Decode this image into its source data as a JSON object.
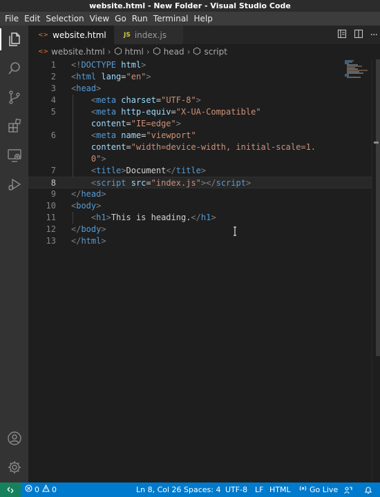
{
  "window": {
    "title": "website.html - New Folder - Visual Studio Code"
  },
  "menu": [
    "File",
    "Edit",
    "Selection",
    "View",
    "Go",
    "Run",
    "Terminal",
    "Help"
  ],
  "tabs": [
    {
      "label": "website.html",
      "icon": "<>",
      "active": true,
      "close": "×"
    },
    {
      "label": "index.js",
      "icon": "JS",
      "active": false
    }
  ],
  "breadcrumb": {
    "file": "website.html",
    "items": [
      "html",
      "head",
      "script"
    ]
  },
  "editor": {
    "current_line": 8,
    "lines": [
      [
        {
          "c": "t",
          "v": "<!"
        },
        {
          "c": "tag",
          "v": "DOCTYPE"
        },
        {
          "c": "txt",
          "v": " "
        },
        {
          "c": "attr",
          "v": "html"
        },
        {
          "c": "t",
          "v": ">"
        }
      ],
      [
        {
          "c": "t",
          "v": "<"
        },
        {
          "c": "tag",
          "v": "html"
        },
        {
          "c": "txt",
          "v": " "
        },
        {
          "c": "attr",
          "v": "lang"
        },
        {
          "c": "txt",
          "v": "="
        },
        {
          "c": "str",
          "v": "\"en\""
        },
        {
          "c": "t",
          "v": ">"
        }
      ],
      [
        {
          "c": "t",
          "v": "<"
        },
        {
          "c": "tag",
          "v": "head"
        },
        {
          "c": "t",
          "v": ">"
        }
      ],
      [
        {
          "c": "txt",
          "v": "    "
        },
        {
          "c": "t",
          "v": "<"
        },
        {
          "c": "tag",
          "v": "meta"
        },
        {
          "c": "txt",
          "v": " "
        },
        {
          "c": "attr",
          "v": "charset"
        },
        {
          "c": "txt",
          "v": "="
        },
        {
          "c": "str",
          "v": "\"UTF-8\""
        },
        {
          "c": "t",
          "v": ">"
        }
      ],
      [
        {
          "c": "txt",
          "v": "    "
        },
        {
          "c": "t",
          "v": "<"
        },
        {
          "c": "tag",
          "v": "meta"
        },
        {
          "c": "txt",
          "v": " "
        },
        {
          "c": "attr",
          "v": "http-equiv"
        },
        {
          "c": "txt",
          "v": "="
        },
        {
          "c": "str",
          "v": "\"X-UA-Compatible\""
        }
      ],
      [
        {
          "c": "txt",
          "v": "    "
        },
        {
          "c": "attr",
          "v": "content"
        },
        {
          "c": "txt",
          "v": "="
        },
        {
          "c": "str",
          "v": "\"IE=edge\""
        },
        {
          "c": "t",
          "v": ">"
        }
      ],
      [
        {
          "c": "txt",
          "v": "    "
        },
        {
          "c": "t",
          "v": "<"
        },
        {
          "c": "tag",
          "v": "meta"
        },
        {
          "c": "txt",
          "v": " "
        },
        {
          "c": "attr",
          "v": "name"
        },
        {
          "c": "txt",
          "v": "="
        },
        {
          "c": "str",
          "v": "\"viewport\""
        }
      ],
      [
        {
          "c": "txt",
          "v": "    "
        },
        {
          "c": "attr",
          "v": "content"
        },
        {
          "c": "txt",
          "v": "="
        },
        {
          "c": "str",
          "v": "\"width=device-width, initial-scale=1."
        }
      ],
      [
        {
          "c": "txt",
          "v": "    "
        },
        {
          "c": "str",
          "v": "0\""
        },
        {
          "c": "t",
          "v": ">"
        }
      ],
      [
        {
          "c": "txt",
          "v": "    "
        },
        {
          "c": "t",
          "v": "<"
        },
        {
          "c": "tag",
          "v": "title"
        },
        {
          "c": "t",
          "v": ">"
        },
        {
          "c": "txt",
          "v": "Document"
        },
        {
          "c": "t",
          "v": "</"
        },
        {
          "c": "tag",
          "v": "title"
        },
        {
          "c": "t",
          "v": ">"
        }
      ],
      [
        {
          "c": "txt",
          "v": "    "
        },
        {
          "c": "t",
          "v": "<"
        },
        {
          "c": "tag",
          "v": "script"
        },
        {
          "c": "txt",
          "v": " "
        },
        {
          "c": "attr",
          "v": "src"
        },
        {
          "c": "txt",
          "v": "="
        },
        {
          "c": "str",
          "v": "\"index.js\""
        },
        {
          "c": "t",
          "v": "></"
        },
        {
          "c": "tag",
          "v": "script"
        },
        {
          "c": "t",
          "v": ">"
        }
      ],
      [
        {
          "c": "t",
          "v": "</"
        },
        {
          "c": "tag",
          "v": "head"
        },
        {
          "c": "t",
          "v": ">"
        }
      ],
      [
        {
          "c": "t",
          "v": "<"
        },
        {
          "c": "tag",
          "v": "body"
        },
        {
          "c": "t",
          "v": ">"
        }
      ],
      [
        {
          "c": "txt",
          "v": "    "
        },
        {
          "c": "t",
          "v": "<"
        },
        {
          "c": "tag",
          "v": "h1"
        },
        {
          "c": "t",
          "v": ">"
        },
        {
          "c": "txt",
          "v": "This is heading."
        },
        {
          "c": "t",
          "v": "</"
        },
        {
          "c": "tag",
          "v": "h1"
        },
        {
          "c": "t",
          "v": ">"
        }
      ],
      [
        {
          "c": "t",
          "v": "</"
        },
        {
          "c": "tag",
          "v": "body"
        },
        {
          "c": "t",
          "v": ">"
        }
      ],
      [
        {
          "c": "t",
          "v": "</"
        },
        {
          "c": "tag",
          "v": "html"
        },
        {
          "c": "t",
          "v": ">"
        }
      ]
    ],
    "line_numbers": [
      "1",
      "2",
      "3",
      "4",
      "5",
      "",
      "6",
      "",
      "",
      "7",
      "8",
      "9",
      "10",
      "11",
      "12",
      "13"
    ]
  },
  "status": {
    "errors": "0",
    "warnings": "0",
    "position": "Ln 8, Col 26",
    "spaces": "Spaces: 4",
    "encoding": "UTF-8",
    "eol": "LF",
    "language": "HTML",
    "go_live": "Go Live"
  },
  "colors": {
    "status_bar": "#007acc",
    "remote_indicator": "#16825d",
    "activity_bar": "#333333",
    "editor_bg": "#1e1e1e"
  },
  "icons": [
    "explorer-icon",
    "search-icon",
    "source-control-icon",
    "extensions-icon",
    "remote-explorer-icon",
    "run-debug-icon",
    "accounts-icon",
    "settings-gear-icon"
  ]
}
